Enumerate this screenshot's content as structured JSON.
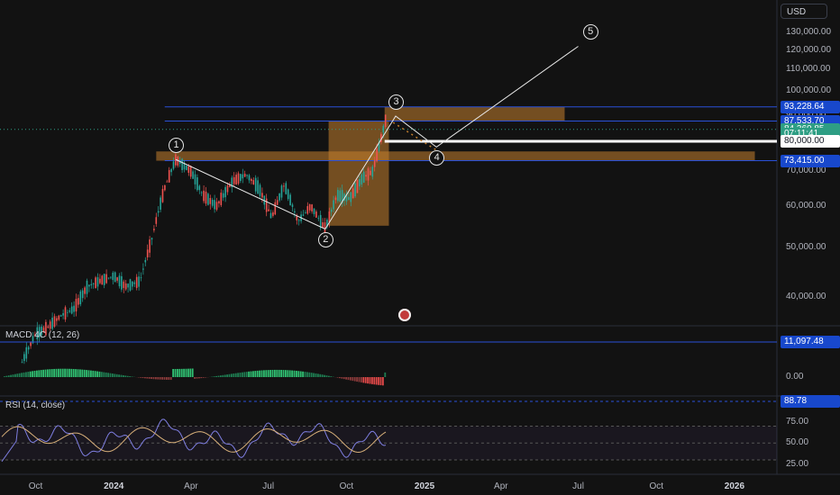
{
  "app": {
    "currency": "USD",
    "flag_icon": "us-flag-icon"
  },
  "price_axis": {
    "ticks": [
      "130,000.00",
      "120,000.00",
      "110,000.00",
      "100,000.00",
      "90,000.00",
      "70,000.00",
      "60,000.00",
      "50,000.00",
      "40,000.00"
    ],
    "tick_values": [
      130000,
      120000,
      110000,
      100000,
      90000,
      70000,
      60000,
      50000,
      40000
    ],
    "labels": [
      {
        "text": "93,228.64",
        "value": 93228.64,
        "bg": "#1848cc",
        "fg": "#ffffff"
      },
      {
        "text": "87,533.70",
        "value": 87533.7,
        "bg": "#1848cc",
        "fg": "#ffffff"
      },
      {
        "text": "84,360.85",
        "value": 84360.85,
        "bg": "#2e9e84",
        "fg": "#ffffff"
      },
      {
        "text": "07:11:41",
        "value": 82700,
        "bg": "#2e9e84",
        "fg": "#ffffff"
      },
      {
        "text": "80,000.00",
        "value": 80000,
        "bg": "#ffffff",
        "fg": "#131722"
      },
      {
        "text": "73,415.00",
        "value": 73415,
        "bg": "#1848cc",
        "fg": "#ffffff"
      }
    ]
  },
  "levels": [
    {
      "value": 93228.64,
      "color": "#2950d8"
    },
    {
      "value": 87533.7,
      "color": "#2950d8"
    },
    {
      "value": 73415,
      "color": "#2950d8"
    },
    {
      "value": 80000,
      "color": "#ffffff"
    }
  ],
  "zones": [
    {
      "from": "2024-11-15",
      "to": "2025-06-15",
      "high": 93228.64,
      "low": 87533.7,
      "color": "#c47f2e"
    },
    {
      "from": "2024-02-20",
      "to": "2026-01-25",
      "high": 76500,
      "low": 73415,
      "color": "#c47f2e"
    },
    {
      "from": "2024-09-10",
      "to": "2024-11-20",
      "high": 87533.7,
      "low": 55000,
      "color": "#c47f2e"
    }
  ],
  "wave_labels": [
    {
      "text": "1",
      "date": "2024-03-14",
      "value": 73800
    },
    {
      "text": "2",
      "date": "2024-09-06",
      "value": 54200
    },
    {
      "text": "3",
      "date": "2024-11-28",
      "value": 89500
    },
    {
      "text": "4",
      "date": "2025-01-15",
      "value": 78000
    },
    {
      "text": "5",
      "date": "2025-07-15",
      "value": 122000
    }
  ],
  "time_axis": {
    "labels": [
      {
        "text": "Oct",
        "date": "2023-10-01",
        "bold": false
      },
      {
        "text": "2024",
        "date": "2024-01-01",
        "bold": true
      },
      {
        "text": "Apr",
        "date": "2024-04-01",
        "bold": false
      },
      {
        "text": "Jul",
        "date": "2024-07-01",
        "bold": false
      },
      {
        "text": "Oct",
        "date": "2024-10-01",
        "bold": false
      },
      {
        "text": "2025",
        "date": "2025-01-01",
        "bold": true
      },
      {
        "text": "Apr",
        "date": "2025-04-01",
        "bold": false
      },
      {
        "text": "Jul",
        "date": "2025-07-01",
        "bold": false
      },
      {
        "text": "Oct",
        "date": "2025-10-01",
        "bold": false
      },
      {
        "text": "2026",
        "date": "2026-01-01",
        "bold": true
      }
    ]
  },
  "macd": {
    "title": "MACD 4C (12, 26)",
    "level_label": "11,097.48",
    "zero_label": "0.00"
  },
  "rsi": {
    "title": "RSI (14, close)",
    "level_label": "88.78",
    "ticks": [
      "75.00",
      "50.00",
      "25.00"
    ],
    "tick_values": [
      75,
      50,
      25
    ]
  },
  "chart_data": {
    "type": "line",
    "title": "",
    "series": [
      {
        "kind": "price",
        "x": [
          "2023-09-15",
          "2023-10-01",
          "2023-10-15",
          "2023-11-01",
          "2023-11-15",
          "2023-12-01",
          "2023-12-15",
          "2024-01-01",
          "2024-01-15",
          "2024-02-01",
          "2024-02-15",
          "2024-03-01",
          "2024-03-14",
          "2024-04-01",
          "2024-04-15",
          "2024-05-01",
          "2024-05-20",
          "2024-06-05",
          "2024-06-20",
          "2024-07-05",
          "2024-07-20",
          "2024-08-05",
          "2024-08-20",
          "2024-09-06",
          "2024-09-20",
          "2024-10-05",
          "2024-10-20",
          "2024-11-01",
          "2024-11-10",
          "2024-11-17"
        ],
        "y": [
          30000,
          34000,
          35000,
          37000,
          38000,
          42000,
          43000,
          44000,
          42000,
          43000,
          52000,
          65000,
          73800,
          70000,
          63000,
          60000,
          67000,
          69000,
          65000,
          57000,
          66000,
          56000,
          60000,
          54200,
          63000,
          62000,
          68000,
          70000,
          80000,
          89000
        ]
      }
    ],
    "wave_path": [
      {
        "date": "2024-03-14",
        "value": 73800
      },
      {
        "date": "2024-09-06",
        "value": 54200
      },
      {
        "date": "2024-11-28",
        "value": 89500
      },
      {
        "date": "2025-01-15",
        "value": 78000
      },
      {
        "date": "2025-07-01",
        "value": 122000
      }
    ],
    "y_range": [
      37000,
      134000
    ],
    "x_range": [
      "2023-08-20",
      "2026-02-20"
    ]
  }
}
